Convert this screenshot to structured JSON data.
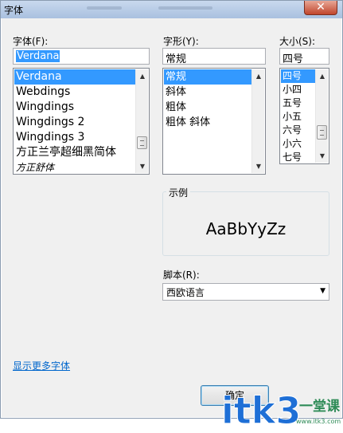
{
  "window": {
    "title": "字体",
    "close_label": "✕"
  },
  "font": {
    "label": "字体(F):",
    "value": "Verdana",
    "items": [
      "Verdana",
      "Webdings",
      "Wingdings",
      "Wingdings 2",
      "Wingdings 3",
      "方正兰亭超细黑简体",
      "方正舒体"
    ],
    "selected": "Verdana"
  },
  "style": {
    "label": "字形(Y):",
    "value": "常规",
    "items": [
      "常规",
      "斜体",
      "粗体",
      "粗体 斜体"
    ],
    "selected": "常规"
  },
  "size": {
    "label": "大小(S):",
    "value": "四号",
    "items": [
      "四号",
      "小四",
      "五号",
      "小五",
      "六号",
      "小六",
      "七号"
    ],
    "selected": "四号"
  },
  "sample": {
    "label": "示例",
    "text": "AaBbYyZz"
  },
  "script": {
    "label": "脚本(R):",
    "value": "西欧语言"
  },
  "links": {
    "more_fonts": "显示更多字体"
  },
  "buttons": {
    "ok": "确定"
  },
  "watermark": {
    "text": "itk3",
    "cn_text": "一堂课",
    "url": "www.itk3.com"
  },
  "colors": {
    "selection": "#3399ff",
    "link": "#0066cc",
    "watermark_blue": "#1e6fd6",
    "watermark_green": "#2e8b57"
  }
}
